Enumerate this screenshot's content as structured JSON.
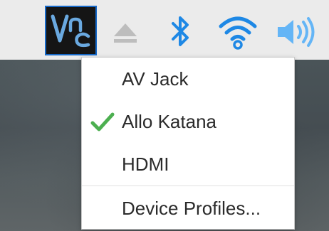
{
  "taskbar": {
    "icons": {
      "vnc": "vnc-icon",
      "eject": "eject-icon",
      "bluetooth": "bluetooth-icon",
      "wifi": "wifi-icon",
      "volume": "volume-icon"
    },
    "colors": {
      "panel_bg": "#ebebeb",
      "accent_blue": "#1e88e5",
      "eject_gray": "#bdbdbd"
    }
  },
  "audio_menu": {
    "items": [
      {
        "label": "AV Jack",
        "selected": false
      },
      {
        "label": "Allo Katana",
        "selected": true
      },
      {
        "label": "HDMI",
        "selected": false
      }
    ],
    "device_profiles_label": "Device Profiles...",
    "check_color": "#4caf50"
  }
}
